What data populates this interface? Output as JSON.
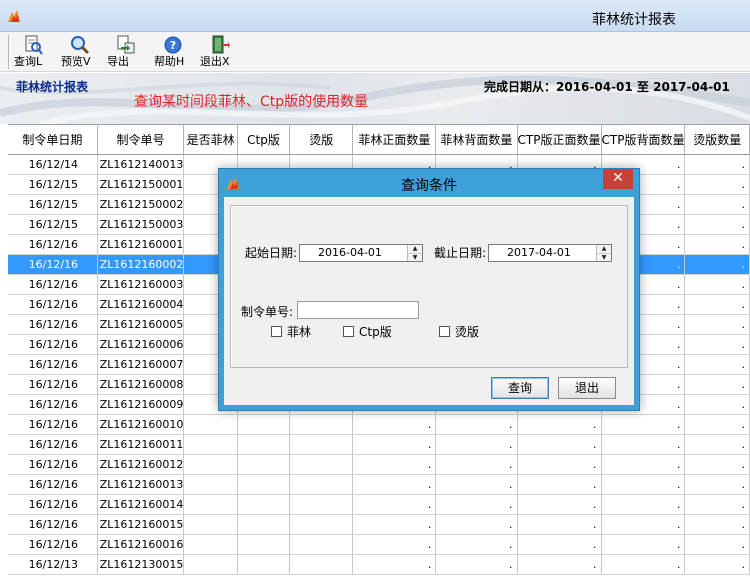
{
  "window": {
    "title": "菲林统计报表",
    "icon": "app-flame-icon"
  },
  "toolbar": {
    "buttons": [
      {
        "label": "查询L",
        "icon": "query-doc-icon"
      },
      {
        "label": "预览V",
        "icon": "magnifier-icon"
      },
      {
        "label": "导出",
        "icon": "export-icon"
      },
      {
        "label": "帮助H",
        "icon": "help-icon"
      },
      {
        "label": "退出X",
        "icon": "exit-door-icon"
      }
    ]
  },
  "banner": {
    "title": "菲林统计报表",
    "note": "查询某时间段菲林、Ctp版的使用数量",
    "range": "完成日期从：2016-04-01  至  2017-04-01"
  },
  "table": {
    "columns": [
      "制令单日期",
      "制令单号",
      "是否菲林",
      "Ctp版",
      "烫版",
      "菲林正面数量",
      "菲林背面数量",
      "CTP版正面数量",
      "CTP版背面数量",
      "烫版数量"
    ],
    "placeholder": ".",
    "selected_index": 5,
    "rows": [
      [
        "16/12/14",
        "ZL1612140013"
      ],
      [
        "16/12/15",
        "ZL1612150001"
      ],
      [
        "16/12/15",
        "ZL1612150002"
      ],
      [
        "16/12/15",
        "ZL1612150003"
      ],
      [
        "16/12/16",
        "ZL1612160001"
      ],
      [
        "16/12/16",
        "ZL1612160002"
      ],
      [
        "16/12/16",
        "ZL1612160003"
      ],
      [
        "16/12/16",
        "ZL1612160004"
      ],
      [
        "16/12/16",
        "ZL1612160005"
      ],
      [
        "16/12/16",
        "ZL1612160006"
      ],
      [
        "16/12/16",
        "ZL1612160007"
      ],
      [
        "16/12/16",
        "ZL1612160008"
      ],
      [
        "16/12/16",
        "ZL1612160009"
      ],
      [
        "16/12/16",
        "ZL1612160010"
      ],
      [
        "16/12/16",
        "ZL1612160011"
      ],
      [
        "16/12/16",
        "ZL1612160012"
      ],
      [
        "16/12/16",
        "ZL1612160013"
      ],
      [
        "16/12/16",
        "ZL1612160014"
      ],
      [
        "16/12/16",
        "ZL1612160015"
      ],
      [
        "16/12/16",
        "ZL1612160016"
      ],
      [
        "16/12/13",
        "ZL1612130015"
      ]
    ]
  },
  "dialog": {
    "title": "查询条件",
    "close_glyph": "✕",
    "start_label": "起始日期:",
    "start_value": "2016-04-01",
    "end_label": "截止日期:",
    "end_value": "2017-04-01",
    "order_label": "制令单号:",
    "order_value": "",
    "checkboxes": [
      {
        "label": "菲林",
        "checked": false
      },
      {
        "label": "Ctp版",
        "checked": false
      },
      {
        "label": "烫版",
        "checked": false
      }
    ],
    "query_button": "查询",
    "exit_button": "退出"
  },
  "colors": {
    "selection": "#3399ff",
    "dialog_frame": "#3f9fd8",
    "close_button": "#c7403a",
    "banner_note": "#e0262b",
    "banner_title": "#0a2a8a"
  }
}
